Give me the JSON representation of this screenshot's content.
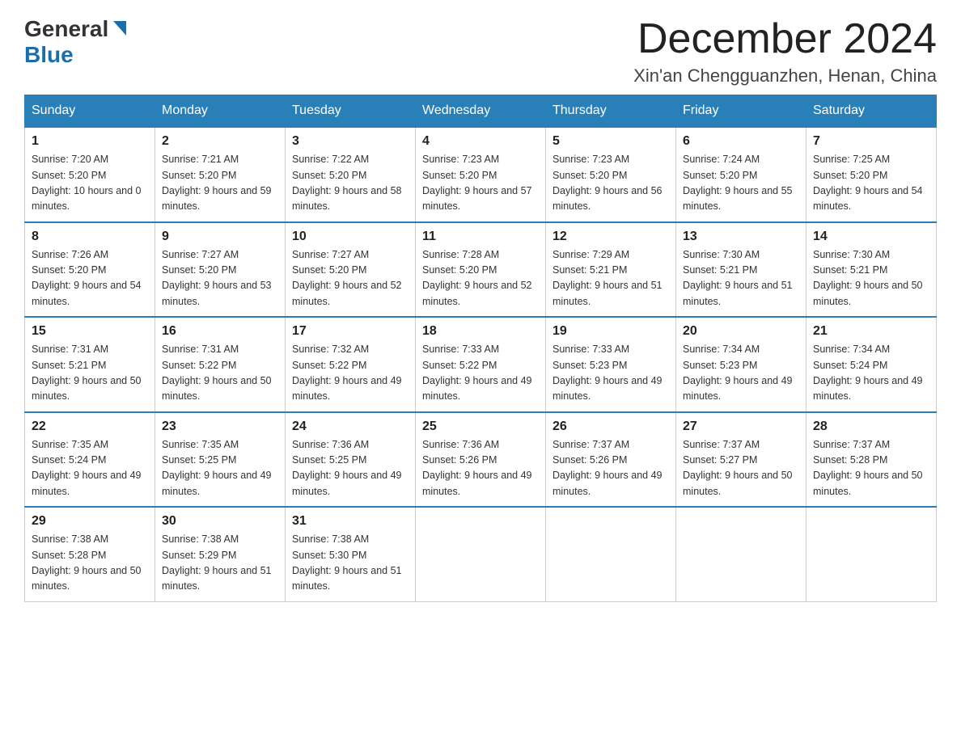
{
  "logo": {
    "general": "General",
    "blue": "Blue",
    "triangle_color": "#1a6fa8"
  },
  "header": {
    "month_year": "December 2024",
    "location": "Xin'an Chengguanzhen, Henan, China"
  },
  "days_of_week": [
    "Sunday",
    "Monday",
    "Tuesday",
    "Wednesday",
    "Thursday",
    "Friday",
    "Saturday"
  ],
  "weeks": [
    [
      {
        "day": "1",
        "sunrise": "7:20 AM",
        "sunset": "5:20 PM",
        "daylight": "10 hours and 0 minutes."
      },
      {
        "day": "2",
        "sunrise": "7:21 AM",
        "sunset": "5:20 PM",
        "daylight": "9 hours and 59 minutes."
      },
      {
        "day": "3",
        "sunrise": "7:22 AM",
        "sunset": "5:20 PM",
        "daylight": "9 hours and 58 minutes."
      },
      {
        "day": "4",
        "sunrise": "7:23 AM",
        "sunset": "5:20 PM",
        "daylight": "9 hours and 57 minutes."
      },
      {
        "day": "5",
        "sunrise": "7:23 AM",
        "sunset": "5:20 PM",
        "daylight": "9 hours and 56 minutes."
      },
      {
        "day": "6",
        "sunrise": "7:24 AM",
        "sunset": "5:20 PM",
        "daylight": "9 hours and 55 minutes."
      },
      {
        "day": "7",
        "sunrise": "7:25 AM",
        "sunset": "5:20 PM",
        "daylight": "9 hours and 54 minutes."
      }
    ],
    [
      {
        "day": "8",
        "sunrise": "7:26 AM",
        "sunset": "5:20 PM",
        "daylight": "9 hours and 54 minutes."
      },
      {
        "day": "9",
        "sunrise": "7:27 AM",
        "sunset": "5:20 PM",
        "daylight": "9 hours and 53 minutes."
      },
      {
        "day": "10",
        "sunrise": "7:27 AM",
        "sunset": "5:20 PM",
        "daylight": "9 hours and 52 minutes."
      },
      {
        "day": "11",
        "sunrise": "7:28 AM",
        "sunset": "5:20 PM",
        "daylight": "9 hours and 52 minutes."
      },
      {
        "day": "12",
        "sunrise": "7:29 AM",
        "sunset": "5:21 PM",
        "daylight": "9 hours and 51 minutes."
      },
      {
        "day": "13",
        "sunrise": "7:30 AM",
        "sunset": "5:21 PM",
        "daylight": "9 hours and 51 minutes."
      },
      {
        "day": "14",
        "sunrise": "7:30 AM",
        "sunset": "5:21 PM",
        "daylight": "9 hours and 50 minutes."
      }
    ],
    [
      {
        "day": "15",
        "sunrise": "7:31 AM",
        "sunset": "5:21 PM",
        "daylight": "9 hours and 50 minutes."
      },
      {
        "day": "16",
        "sunrise": "7:31 AM",
        "sunset": "5:22 PM",
        "daylight": "9 hours and 50 minutes."
      },
      {
        "day": "17",
        "sunrise": "7:32 AM",
        "sunset": "5:22 PM",
        "daylight": "9 hours and 49 minutes."
      },
      {
        "day": "18",
        "sunrise": "7:33 AM",
        "sunset": "5:22 PM",
        "daylight": "9 hours and 49 minutes."
      },
      {
        "day": "19",
        "sunrise": "7:33 AM",
        "sunset": "5:23 PM",
        "daylight": "9 hours and 49 minutes."
      },
      {
        "day": "20",
        "sunrise": "7:34 AM",
        "sunset": "5:23 PM",
        "daylight": "9 hours and 49 minutes."
      },
      {
        "day": "21",
        "sunrise": "7:34 AM",
        "sunset": "5:24 PM",
        "daylight": "9 hours and 49 minutes."
      }
    ],
    [
      {
        "day": "22",
        "sunrise": "7:35 AM",
        "sunset": "5:24 PM",
        "daylight": "9 hours and 49 minutes."
      },
      {
        "day": "23",
        "sunrise": "7:35 AM",
        "sunset": "5:25 PM",
        "daylight": "9 hours and 49 minutes."
      },
      {
        "day": "24",
        "sunrise": "7:36 AM",
        "sunset": "5:25 PM",
        "daylight": "9 hours and 49 minutes."
      },
      {
        "day": "25",
        "sunrise": "7:36 AM",
        "sunset": "5:26 PM",
        "daylight": "9 hours and 49 minutes."
      },
      {
        "day": "26",
        "sunrise": "7:37 AM",
        "sunset": "5:26 PM",
        "daylight": "9 hours and 49 minutes."
      },
      {
        "day": "27",
        "sunrise": "7:37 AM",
        "sunset": "5:27 PM",
        "daylight": "9 hours and 50 minutes."
      },
      {
        "day": "28",
        "sunrise": "7:37 AM",
        "sunset": "5:28 PM",
        "daylight": "9 hours and 50 minutes."
      }
    ],
    [
      {
        "day": "29",
        "sunrise": "7:38 AM",
        "sunset": "5:28 PM",
        "daylight": "9 hours and 50 minutes."
      },
      {
        "day": "30",
        "sunrise": "7:38 AM",
        "sunset": "5:29 PM",
        "daylight": "9 hours and 51 minutes."
      },
      {
        "day": "31",
        "sunrise": "7:38 AM",
        "sunset": "5:30 PM",
        "daylight": "9 hours and 51 minutes."
      },
      null,
      null,
      null,
      null
    ]
  ],
  "labels": {
    "sunrise": "Sunrise:",
    "sunset": "Sunset:",
    "daylight": "Daylight:"
  }
}
